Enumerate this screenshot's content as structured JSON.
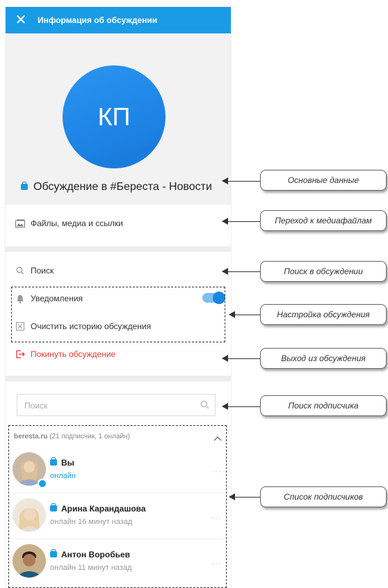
{
  "header": {
    "title": "Информация об обсуждении",
    "close_icon": "close-icon"
  },
  "chat": {
    "initials": "КП",
    "name": "Обсуждение в #Береста - Новости"
  },
  "menu": {
    "files": "Файлы, медиа и ссылки",
    "search": "Поиск",
    "notifications": "Уведомления",
    "notifications_enabled": true,
    "clear_history": "Очистить историю обсуждения",
    "leave": "Покинуть обсуждение"
  },
  "subscribers": {
    "search_placeholder": "Поиск",
    "domain": "beresta.ru",
    "count_text": "(21 подписчик, 1 онлайн)",
    "members": [
      {
        "name": "Вы",
        "status": "онлайн"
      },
      {
        "name": "Арина Карандашова",
        "status": "онлайн 16 минут назад"
      },
      {
        "name": "Антон Воробьев",
        "status": "онлайн 11 минут назад"
      }
    ],
    "more_label": "···"
  },
  "callouts": {
    "main_data": "Основные данные",
    "media": "Переход к медиафайлам",
    "search_chat": "Поиск в обсуждении",
    "settings": "Настройка обсуждения",
    "leave": "Выход из обсуждения",
    "search_subscriber": "Поиск подписчика",
    "subscriber_list": "Список подписчиков"
  },
  "colors": {
    "accent": "#1a9be6",
    "danger": "#e53935"
  }
}
